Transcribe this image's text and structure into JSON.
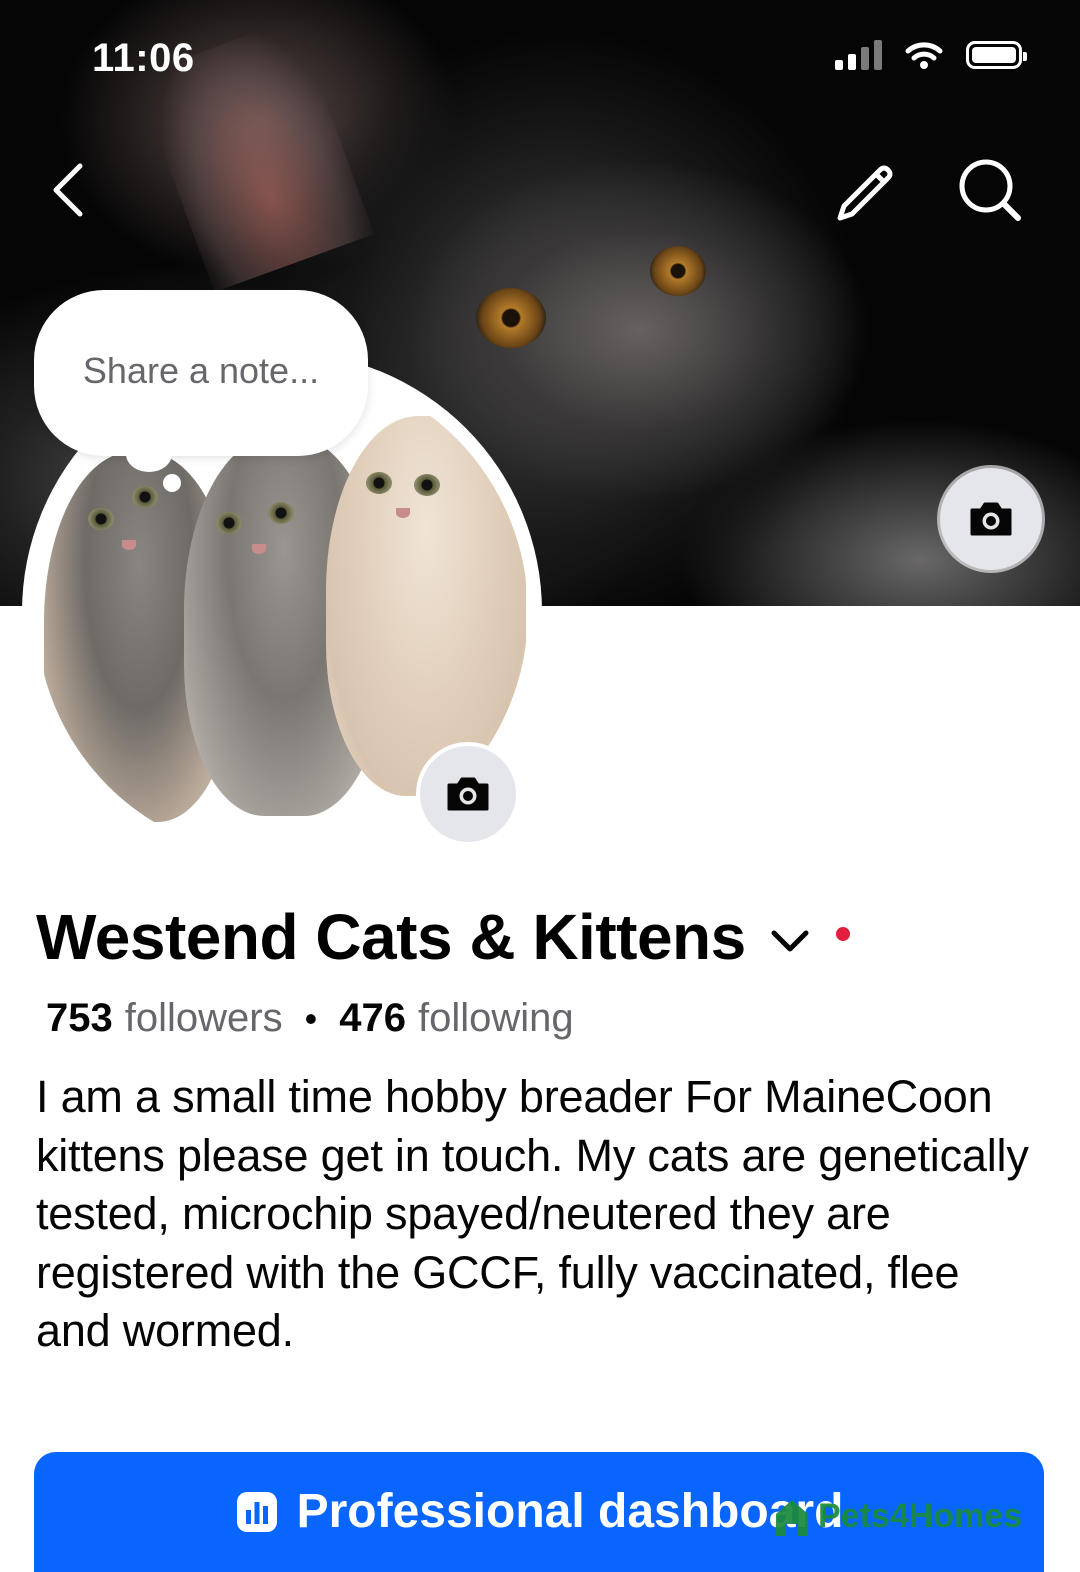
{
  "status_bar": {
    "time": "11:06"
  },
  "note_bubble": {
    "placeholder": "Share a note..."
  },
  "profile": {
    "name": "Westend Cats & Kittens",
    "followers_count": "753",
    "followers_label": "followers",
    "separator": "•",
    "following_count": "476",
    "following_label": "following",
    "bio": "I am a small time hobby breader For MaineCoon kittens please get in touch. My cats are genetically tested, microchip spayed/neutered they are registered with the GCCF, fully vaccinated, flee and wormed."
  },
  "actions": {
    "dashboard_label": "Professional dashboard"
  },
  "watermark": {
    "text": "Pets4Homes"
  },
  "colors": {
    "primary_button": "#0866ff",
    "notification_dot": "#e41e3f",
    "secondary_text": "#65676b",
    "camera_button_bg": "#e4e6eb"
  },
  "icons": {
    "back": "chevron-left-icon",
    "edit": "pencil-icon",
    "search": "search-icon",
    "cover_camera": "camera-icon",
    "avatar_camera": "camera-icon",
    "name_dropdown": "chevron-down-icon",
    "dashboard": "bar-chart-icon"
  }
}
